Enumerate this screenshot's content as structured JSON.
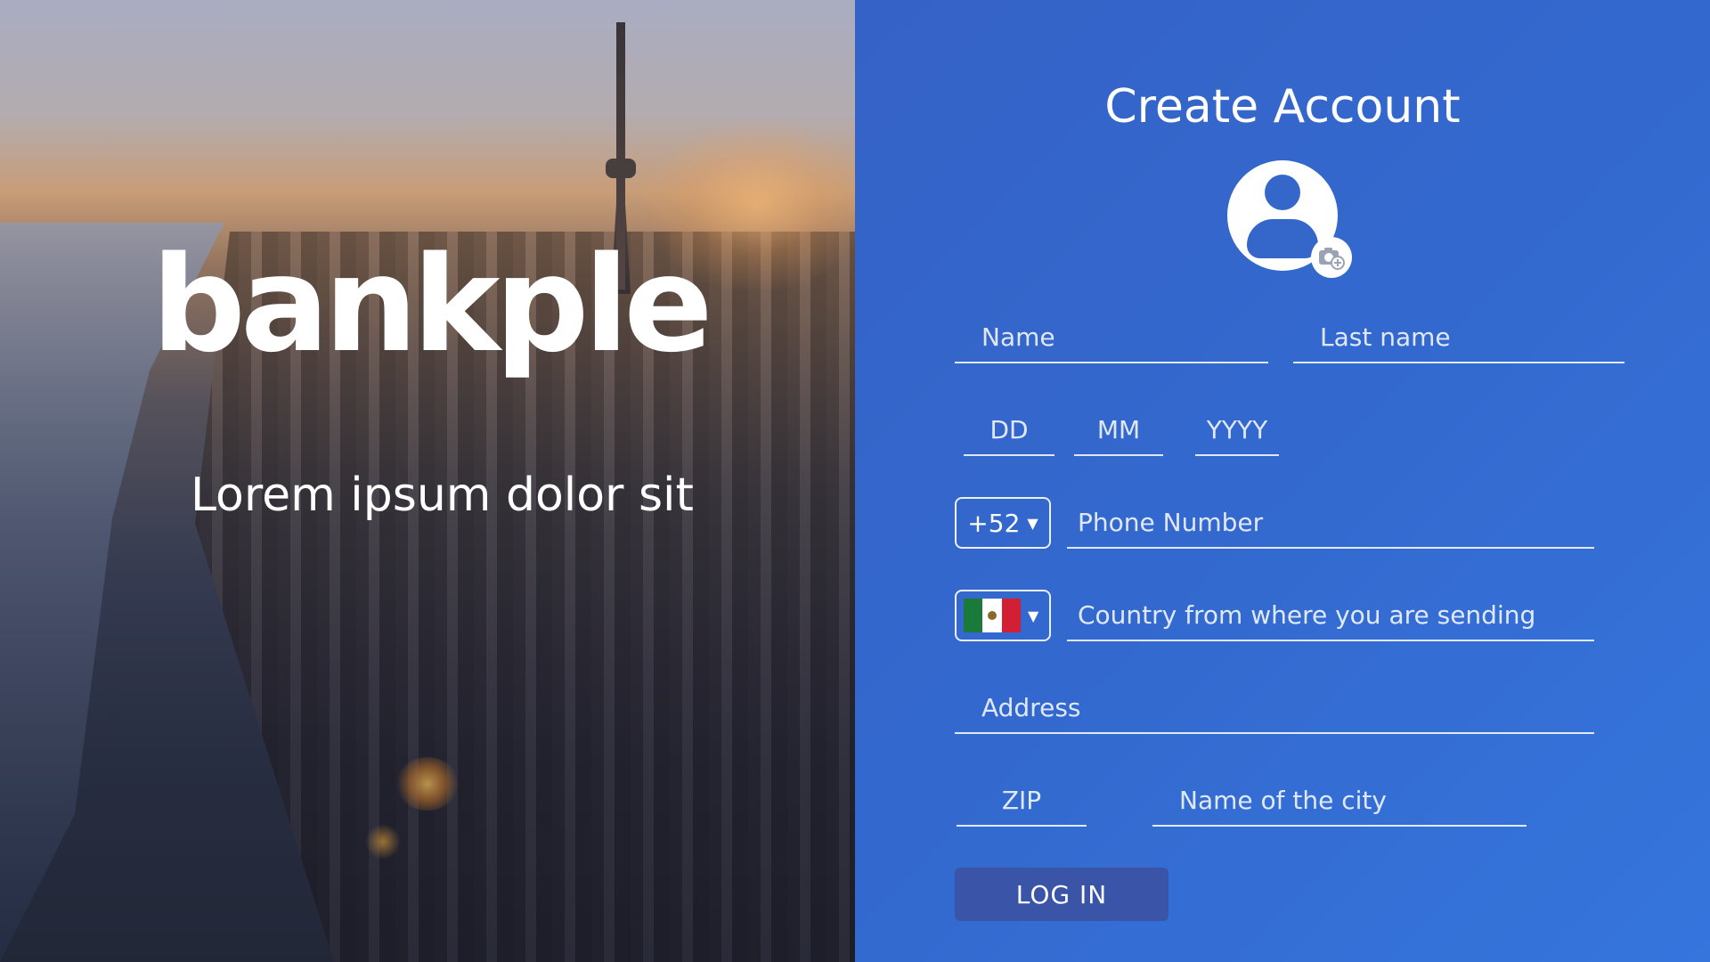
{
  "hero": {
    "brand": "bankple",
    "tagline": "Lorem ipsum dolor sit"
  },
  "form": {
    "title": "Create Account",
    "name_placeholder": "Name",
    "lastname_placeholder": "Last name",
    "day_placeholder": "DD",
    "month_placeholder": "MM",
    "year_placeholder": "YYYY",
    "phone_code": "+52",
    "phone_placeholder": "Phone Number",
    "country_flag": "mexico-flag",
    "country_placeholder": "Country from where you are sending",
    "address_placeholder": "Address",
    "zip_placeholder": "ZIP",
    "city_placeholder": "Name of the city",
    "login_label": "LOG IN"
  },
  "icons": {
    "avatar": "user-avatar-icon",
    "camera": "camera-add-icon",
    "caret": "caret-down-icon"
  },
  "colors": {
    "panel": "#3369cf",
    "button": "#3a55a8",
    "text": "#ffffff"
  }
}
